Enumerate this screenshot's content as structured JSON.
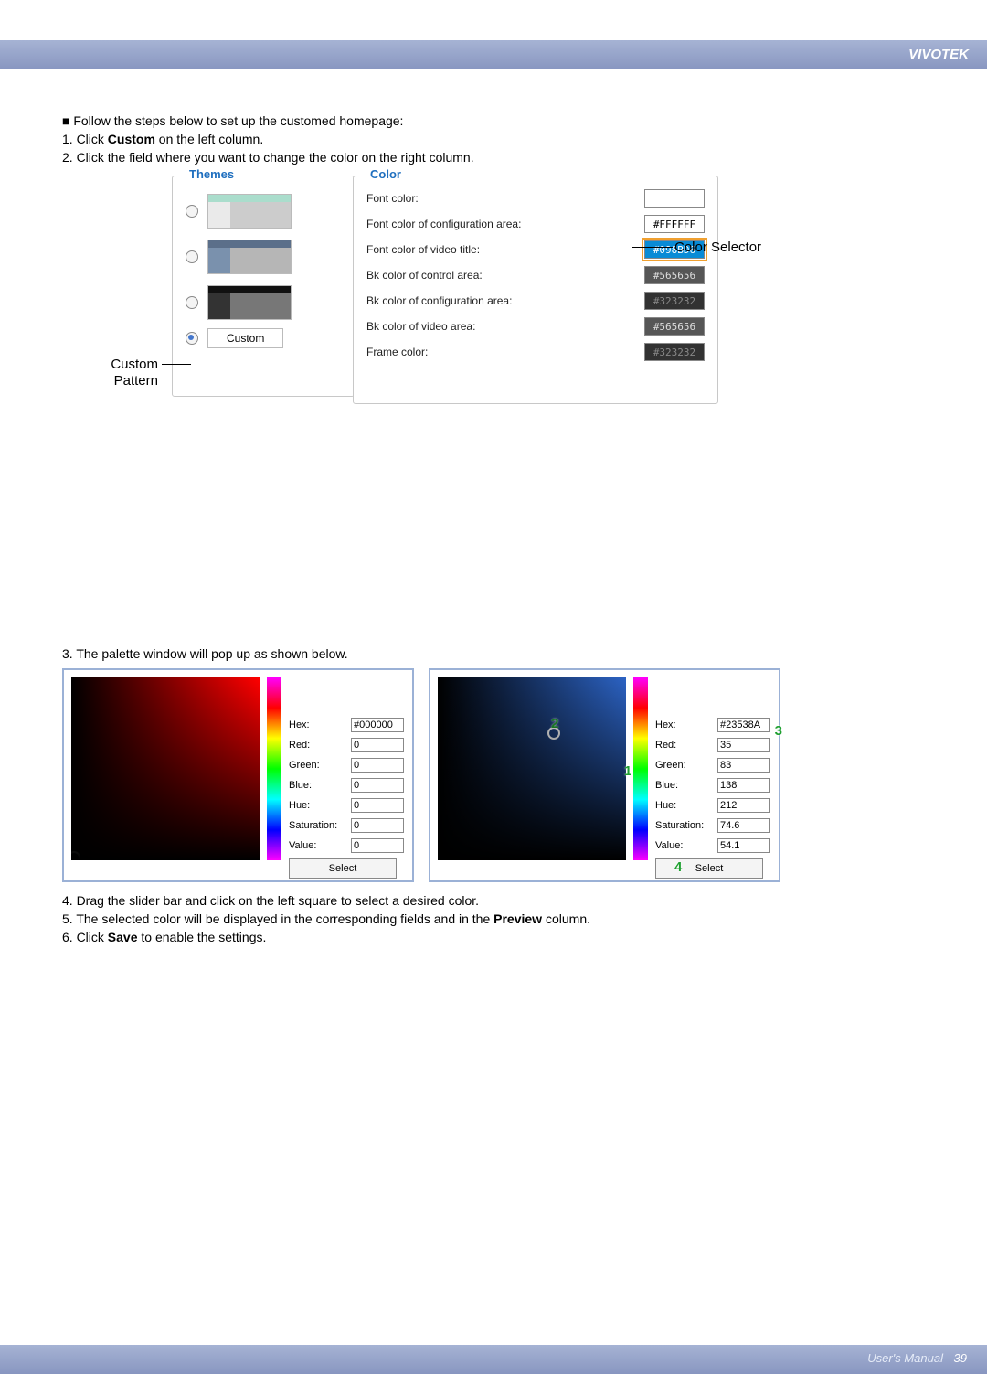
{
  "brand": "VIVOTEK",
  "intro": {
    "line0": "■ Follow the steps below to set up the customed homepage:",
    "line1_a": "1. Click ",
    "line1_bold": "Custom",
    "line1_b": " on the left column.",
    "line2": "2. Click the field where you want to change the color on the right column."
  },
  "themes": {
    "title": "Themes",
    "custom_label": "Custom"
  },
  "color": {
    "title": "Color",
    "rows": [
      {
        "label": "Font color:",
        "value": "",
        "bg": "#ffffff",
        "fg": "#000000"
      },
      {
        "label": "Font color of configuration area:",
        "value": "#FFFFFF",
        "bg": "#ffffff",
        "fg": "#000000"
      },
      {
        "label": "Font color of video title:",
        "value": "#098BD6",
        "bg": "#098BD6",
        "fg": "#ffffff",
        "hi": true
      },
      {
        "label": "Bk color of control area:",
        "value": "#565656",
        "bg": "#565656",
        "fg": "#dddddd"
      },
      {
        "label": "Bk color of configuration area:",
        "value": "#323232",
        "bg": "#323232",
        "fg": "#888888"
      },
      {
        "label": "Bk color of video area:",
        "value": "#565656",
        "bg": "#565656",
        "fg": "#dddddd"
      },
      {
        "label": "Frame color:",
        "value": "#323232",
        "bg": "#323232",
        "fg": "#888888"
      }
    ]
  },
  "annot": {
    "custom_pattern_a": "Custom",
    "custom_pattern_b": "Pattern",
    "color_selector": "Color Selector"
  },
  "step3": "3. The palette window will pop up as shown below.",
  "palette1": {
    "hex_label": "Hex:",
    "hex": "#000000",
    "red_label": "Red:",
    "red": "0",
    "green_label": "Green:",
    "green": "0",
    "blue_label": "Blue:",
    "blue": "0",
    "hue_label": "Hue:",
    "hue": "0",
    "sat_label": "Saturation:",
    "sat": "0",
    "val_label": "Value:",
    "val": "0",
    "select": "Select"
  },
  "palette2": {
    "hex_label": "Hex:",
    "hex": "#23538A",
    "red_label": "Red:",
    "red": "35",
    "green_label": "Green:",
    "green": "83",
    "blue_label": "Blue:",
    "blue": "138",
    "hue_label": "Hue:",
    "hue": "212",
    "sat_label": "Saturation:",
    "sat": "74.6",
    "val_label": "Value:",
    "val": "54.1",
    "select": "Select",
    "m1": "1",
    "m2": "2",
    "m3": "3",
    "m4": "4"
  },
  "steps_after": {
    "s4": "4. Drag the slider bar and click on the left square to select a desired color.",
    "s5_a": "5. The selected color will be displayed in the corresponding fields and in the ",
    "s5_bold": "Preview",
    "s5_b": " column.",
    "s6_a": "6. Click ",
    "s6_bold": "Save",
    "s6_b": " to enable the settings."
  },
  "footer": {
    "label": "User's Manual - ",
    "page": "39"
  }
}
